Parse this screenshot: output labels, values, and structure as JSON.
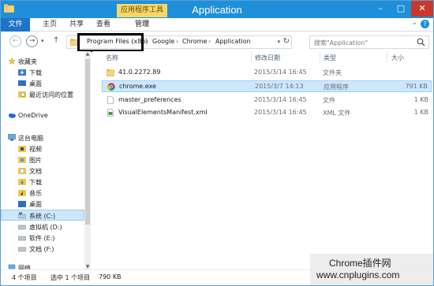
{
  "window": {
    "title": "Application"
  },
  "window_controls": {
    "minimize": "–",
    "maximize": "□",
    "close": "✕"
  },
  "ribbon": {
    "tabs": [
      {
        "label": "文件"
      },
      {
        "label": "主页"
      },
      {
        "label": "共享"
      },
      {
        "label": "查看"
      }
    ],
    "tool_header": "应用程序工具",
    "manage": "管理",
    "expand": "⌄",
    "help": "?"
  },
  "nav": {
    "back": "←",
    "forward": "→",
    "dropdown": "▾",
    "up": "↑"
  },
  "address": {
    "crumbs": [
      "Program Files (x86)",
      "Google",
      "Chrome",
      "Application"
    ],
    "separator": "›",
    "dropdown": "▾",
    "refresh": "↻"
  },
  "search": {
    "placeholder": "搜索\"Application\""
  },
  "sidebar": {
    "items": [
      {
        "label": "收藏夹",
        "icon": "star-icon"
      },
      {
        "label": "下载",
        "icon": "download-folder-icon"
      },
      {
        "label": "桌面",
        "icon": "desktop-icon"
      },
      {
        "label": "最近访问的位置",
        "icon": "recent-places-icon"
      },
      {
        "label": "OneDrive",
        "icon": "onedrive-icon"
      },
      {
        "label": "这台电脑",
        "icon": "computer-icon"
      },
      {
        "label": "视频",
        "icon": "videos-folder-icon"
      },
      {
        "label": "图片",
        "icon": "pictures-folder-icon"
      },
      {
        "label": "文档",
        "icon": "documents-folder-icon"
      },
      {
        "label": "下载",
        "icon": "downloads-folder-icon"
      },
      {
        "label": "音乐",
        "icon": "music-folder-icon"
      },
      {
        "label": "桌面",
        "icon": "desktop-folder-icon"
      },
      {
        "label": "系统 (C:)",
        "icon": "system-drive-icon"
      },
      {
        "label": "虚拟机 (D:)",
        "icon": "drive-icon"
      },
      {
        "label": "软件 (E:)",
        "icon": "drive-icon"
      },
      {
        "label": "文档 (F:)",
        "icon": "drive-icon"
      },
      {
        "label": "网络",
        "icon": "network-icon"
      }
    ]
  },
  "columns": {
    "name": "名称",
    "date": "修改日期",
    "type": "类型",
    "size": "大小"
  },
  "files": [
    {
      "name": "41.0.2272.89",
      "date": "2015/3/14 16:45",
      "type": "文件夹",
      "size": "",
      "icon": "folder-icon"
    },
    {
      "name": "chrome.exe",
      "date": "2015/3/7 14:13",
      "type": "应用程序",
      "size": "791 KB",
      "icon": "chrome-icon"
    },
    {
      "name": "master_preferences",
      "date": "2015/3/14 16:45",
      "type": "文件",
      "size": "1 KB",
      "icon": "file-icon"
    },
    {
      "name": "VisualElementsManifest.xml",
      "date": "2015/3/14 16:45",
      "type": "XML 文件",
      "size": "1 KB",
      "icon": "xml-file-icon"
    }
  ],
  "status": {
    "count": "4 个项目",
    "selected": "选中 1 个项目",
    "size": "790 KB"
  },
  "watermark": {
    "line1": "Chrome插件网",
    "line2": "www.cnplugins.com"
  },
  "colors": {
    "title_bar": "#1e8fd8",
    "file_tab": "#1e74c6",
    "tool_header": "#f6d76a",
    "selection": "#cce8ff",
    "highlight_box": "#000000"
  }
}
